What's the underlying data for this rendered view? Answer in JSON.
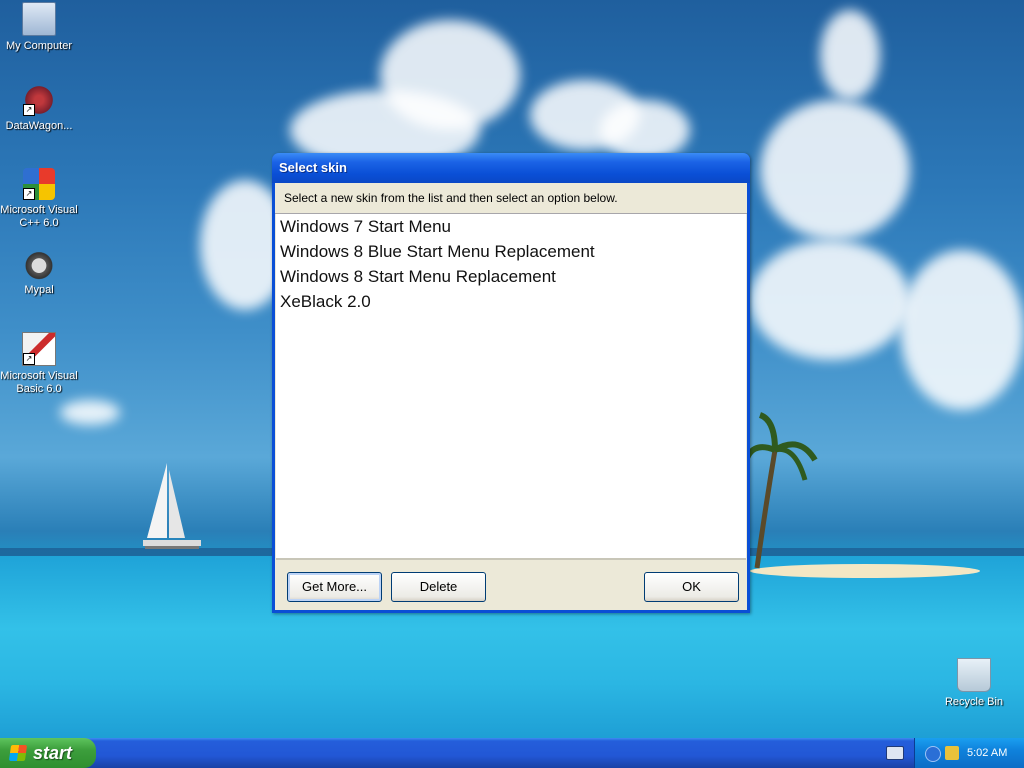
{
  "desktop": {
    "icons": [
      {
        "label": "My Computer",
        "icon": "my-computer-icon"
      },
      {
        "label": "DataWagon...",
        "icon": "datawagon-icon"
      },
      {
        "label": "Microsoft Visual C++ 6.0",
        "icon": "visual-cpp-icon"
      },
      {
        "label": "Mypal",
        "icon": "mypal-icon"
      },
      {
        "label": "Microsoft Visual Basic 6.0",
        "icon": "visual-basic-icon"
      },
      {
        "label": "Recycle Bin",
        "icon": "recycle-bin-icon"
      }
    ]
  },
  "dialog": {
    "title": "Select skin",
    "instruction": "Select a new skin from the list and then select an option below.",
    "skins": [
      "Windows 7 Start Menu",
      "Windows 8 Blue Start Menu Replacement",
      "Windows 8 Start Menu Replacement",
      "XeBlack 2.0"
    ],
    "buttons": {
      "get_more": "Get More...",
      "delete": "Delete",
      "ok": "OK"
    }
  },
  "taskbar": {
    "start_label": "start",
    "clock": "5:02 AM"
  }
}
